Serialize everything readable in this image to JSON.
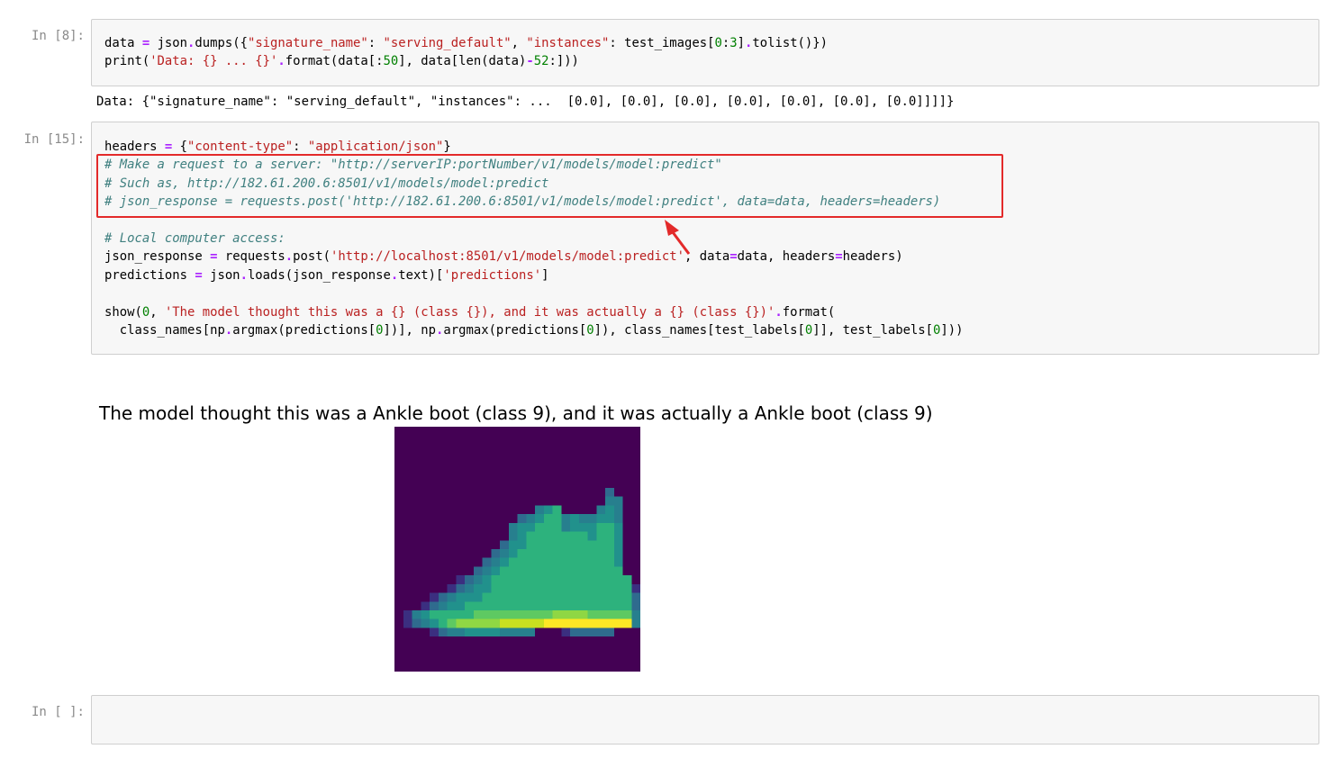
{
  "cells": [
    {
      "prompt": "In [8]:",
      "code_lines": [
        [
          [
            "data ",
            ""
          ],
          [
            "=",
            "op"
          ],
          [
            " json",
            ""
          ],
          [
            ".",
            "op"
          ],
          [
            "dumps({",
            ""
          ],
          [
            "\"signature_name\"",
            "str"
          ],
          [
            ": ",
            ""
          ],
          [
            "\"serving_default\"",
            "str"
          ],
          [
            ", ",
            ""
          ],
          [
            "\"instances\"",
            "str"
          ],
          [
            ": test_images[",
            ""
          ],
          [
            "0",
            "num"
          ],
          [
            ":",
            ""
          ],
          [
            "3",
            "num"
          ],
          [
            "]",
            ""
          ],
          [
            ".",
            "op"
          ],
          [
            "tolist()})",
            ""
          ]
        ],
        [
          [
            "print(",
            ""
          ],
          [
            "'Data: {} ... {}'",
            "str"
          ],
          [
            ".",
            "op"
          ],
          [
            "format(data[:",
            ""
          ],
          [
            "50",
            "num"
          ],
          [
            "], data[len(data)",
            ""
          ],
          [
            "-",
            "op"
          ],
          [
            "52",
            "num"
          ],
          [
            ":]))",
            ""
          ]
        ]
      ],
      "output": "Data: {\"signature_name\": \"serving_default\", \"instances\": ...  [0.0], [0.0], [0.0], [0.0], [0.0], [0.0], [0.0]]]]}"
    },
    {
      "prompt": "In [15]:",
      "code_lines": [
        [
          [
            "headers ",
            ""
          ],
          [
            "=",
            "op"
          ],
          [
            " {",
            ""
          ],
          [
            "\"content-type\"",
            "str"
          ],
          [
            ": ",
            ""
          ],
          [
            "\"application/json\"",
            "str"
          ],
          [
            "}",
            ""
          ]
        ],
        [
          [
            "# Make a request to a server: \"http://serverIP:portNumber/v1/models/model:predict\"",
            "com"
          ]
        ],
        [
          [
            "# Such as, http://182.61.200.6:8501/v1/models/model:predict",
            "com"
          ]
        ],
        [
          [
            "# json_response = requests.post('http://182.61.200.6:8501/v1/models/model:predict', data=data, headers=headers)",
            "com"
          ]
        ],
        [],
        [
          [
            "# Local computer access:",
            "com"
          ]
        ],
        [
          [
            "json_response ",
            ""
          ],
          [
            "=",
            "op"
          ],
          [
            " requests",
            ""
          ],
          [
            ".",
            "op"
          ],
          [
            "post(",
            ""
          ],
          [
            "'http://localhost:8501/v1/models/model:predict'",
            "str"
          ],
          [
            ", data",
            ""
          ],
          [
            "=",
            "op"
          ],
          [
            "data, headers",
            ""
          ],
          [
            "=",
            "op"
          ],
          [
            "headers)",
            ""
          ]
        ],
        [
          [
            "predictions ",
            ""
          ],
          [
            "=",
            "op"
          ],
          [
            " json",
            ""
          ],
          [
            ".",
            "op"
          ],
          [
            "loads(json_response",
            ""
          ],
          [
            ".",
            "op"
          ],
          [
            "text)[",
            ""
          ],
          [
            "'predictions'",
            "str"
          ],
          [
            "]",
            ""
          ]
        ],
        [],
        [
          [
            "show(",
            ""
          ],
          [
            "0",
            "num"
          ],
          [
            ", ",
            ""
          ],
          [
            "'The model thought this was a {} (class {}), and it was actually a {} (class {})'",
            "str"
          ],
          [
            ".",
            "op"
          ],
          [
            "format(",
            ""
          ]
        ],
        [
          [
            "  class_names[np",
            ""
          ],
          [
            ".",
            "op"
          ],
          [
            "argmax(predictions[",
            ""
          ],
          [
            "0",
            "num"
          ],
          [
            "])], np",
            ""
          ],
          [
            ".",
            "op"
          ],
          [
            "argmax(predictions[",
            ""
          ],
          [
            "0",
            "num"
          ],
          [
            "]), class_names[test_labels[",
            ""
          ],
          [
            "0",
            "num"
          ],
          [
            "]], test_labels[",
            ""
          ],
          [
            "0",
            "num"
          ],
          [
            "]))",
            ""
          ]
        ]
      ],
      "plot_title": "The model thought this was a Ankle boot (class 9), and it was actually a Ankle boot (class 9)"
    },
    {
      "prompt": "In [ ]:"
    }
  ],
  "colors": {
    "string": "#ba2121",
    "operator": "#aa22ff",
    "number": "#008000",
    "comment": "#408080",
    "highlight": "#e32a2a",
    "prompt": "#8a8a8a",
    "image_background": "#440154"
  },
  "image": {
    "description_icon": "ankle-boot-image",
    "grid": [
      "0000000000000000000000000000",
      "0000000000000000000000000000",
      "0000000000000000000000000000",
      "0000000000000000000000000000",
      "0000000000000000000000000000",
      "0000000000000000000000000000",
      "0000000000000000000000000000",
      "0000000000000000000000002000",
      "0000000000000000000000003300",
      "0000000000000000345000034300",
      "0000000000000023455343344300",
      "0000000000000344555344455400",
      "0000000000000345555555455400",
      "0000000000002445555555555400",
      "0000000000023455555555555400",
      "0000000000234555555555555400",
      "0000000002345555555555555500",
      "0000000123455555555555555550",
      "0000001234455555555555555551",
      "0000123444555555555555555552",
      "0001234455555555555555555552",
      "0134555556666666667777666663",
      "0123456777778888899999999993",
      "0000123344443333000122222000",
      "0000000000000000000000000000",
      "0000000000000000000000000000",
      "0000000000000000000000000000",
      "0000000000000000000000000000"
    ],
    "palette": [
      "#440154",
      "#3b2f80",
      "#2f6b8e",
      "#277f8e",
      "#21918c",
      "#2db27d",
      "#5ec962",
      "#8fd744",
      "#c8e020",
      "#fde725"
    ]
  }
}
